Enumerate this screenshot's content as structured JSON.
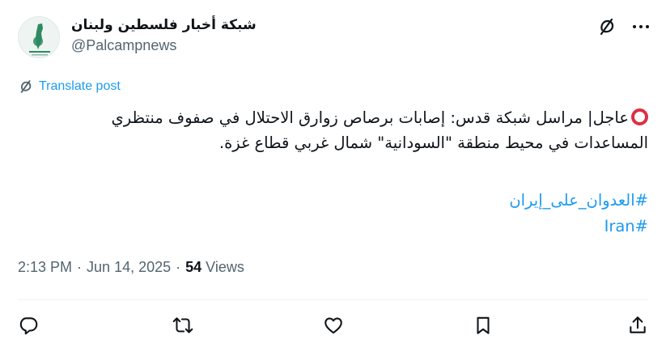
{
  "author": {
    "display_name": "شبكة أخبار فلسطين ولبنان",
    "handle": "@Palcampnews",
    "avatar_icon": "palestine-map-logo"
  },
  "header_actions": {
    "grok_icon": "grok-icon",
    "more_icon": "more-dots-icon"
  },
  "translate": {
    "label": "Translate post",
    "icon": "translate-icon"
  },
  "tweet": {
    "lines": [
      "عاجل| مراسل شبكة قدس: إصابات برصاص زوارق الاحتلال في صفوف منتظري",
      "المساعدات في محيط منطقة \"السودانية\" شمال غربي قطاع غزة."
    ],
    "hashtags": [
      "#العدوان_على_إيران",
      "#Iran"
    ],
    "accent_color": "#1d9bf0",
    "mark_color": "#dd2e44"
  },
  "meta": {
    "time": "2:13 PM",
    "date": "Jun 14, 2025",
    "separator": "·",
    "views_count": "54",
    "views_label": "Views"
  },
  "actions": [
    "reply-icon",
    "retweet-icon",
    "like-icon",
    "bookmark-icon",
    "share-icon"
  ]
}
